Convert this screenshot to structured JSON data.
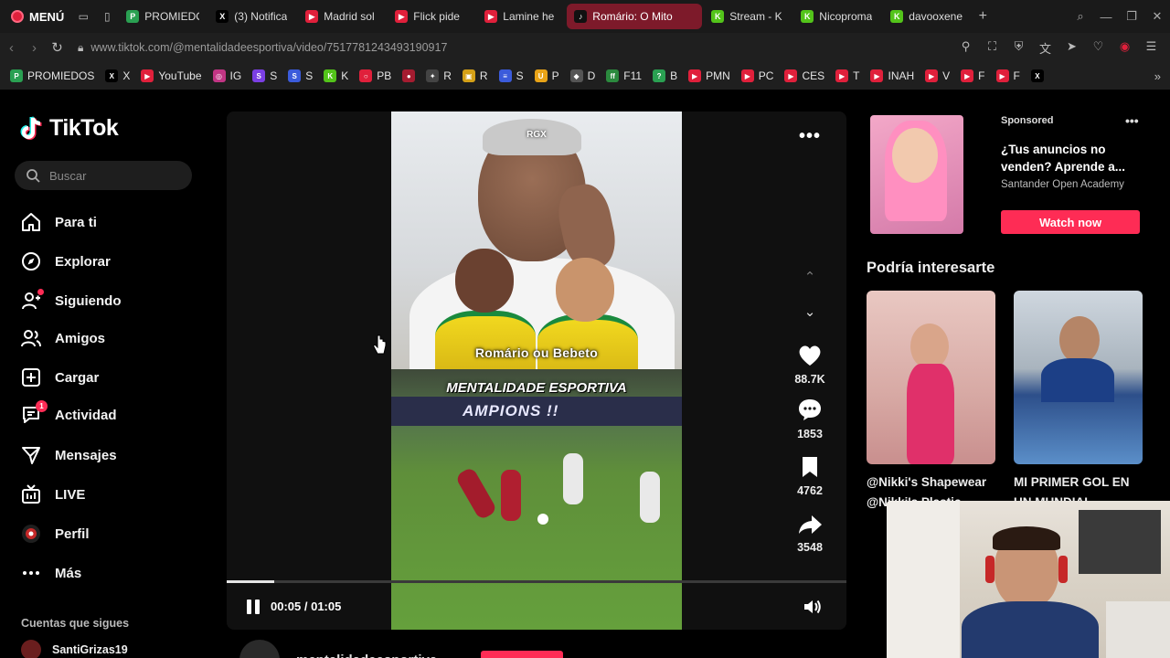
{
  "browser": {
    "menu_label": "MENÚ",
    "tabs": [
      {
        "title": "PROMIEDO",
        "color": "#2aa052",
        "glyph": "P",
        "active": false
      },
      {
        "title": "(3) Notifica",
        "color": "#000000",
        "glyph": "X",
        "active": false
      },
      {
        "title": "Madrid sol",
        "color": "#e0203b",
        "glyph": "▶",
        "active": false
      },
      {
        "title": "Flick pide",
        "color": "#e0203b",
        "glyph": "▶",
        "active": false
      },
      {
        "title": "Lamine he",
        "color": "#e0203b",
        "glyph": "▶",
        "active": false
      },
      {
        "title": "Romário: O Mito",
        "color": "#111111",
        "glyph": "♪",
        "active": true
      },
      {
        "title": "Stream - K",
        "color": "#53c41a",
        "glyph": "K",
        "active": false
      },
      {
        "title": "Nicoproma",
        "color": "#53c41a",
        "glyph": "K",
        "active": false
      },
      {
        "title": "davooxene",
        "color": "#53c41a",
        "glyph": "K",
        "active": false
      }
    ],
    "url": "www.tiktok.com/@mentalidadeesportiva/video/7517781243493190917",
    "bookmarks": [
      {
        "label": "PROMIEDOS",
        "color": "#2aa052",
        "glyph": "P"
      },
      {
        "label": "X",
        "color": "#000000",
        "glyph": "X"
      },
      {
        "label": "YouTube",
        "color": "#e0203b",
        "glyph": "▶"
      },
      {
        "label": "IG",
        "color": "#c13584",
        "glyph": "◎"
      },
      {
        "label": "S",
        "color": "#7b3fe4",
        "glyph": "S"
      },
      {
        "label": "S",
        "color": "#3b5bdb",
        "glyph": "S"
      },
      {
        "label": "K",
        "color": "#53c41a",
        "glyph": "K"
      },
      {
        "label": "PB",
        "color": "#e0203b",
        "glyph": "○"
      },
      {
        "label": "",
        "color": "#a51c30",
        "glyph": "●"
      },
      {
        "label": "R",
        "color": "#444444",
        "glyph": "✦"
      },
      {
        "label": "R",
        "color": "#d4a017",
        "glyph": "▣"
      },
      {
        "label": "S",
        "color": "#3b5bdb",
        "glyph": "≡"
      },
      {
        "label": "P",
        "color": "#e8a317",
        "glyph": "U"
      },
      {
        "label": "D",
        "color": "#555555",
        "glyph": "◆"
      },
      {
        "label": "F11",
        "color": "#2b8a3e",
        "glyph": "ff"
      },
      {
        "label": "B",
        "color": "#2aa052",
        "glyph": "?"
      },
      {
        "label": "PMN",
        "color": "#e0203b",
        "glyph": "▶"
      },
      {
        "label": "PC",
        "color": "#e0203b",
        "glyph": "▶"
      },
      {
        "label": "CES",
        "color": "#e0203b",
        "glyph": "▶"
      },
      {
        "label": "T",
        "color": "#e0203b",
        "glyph": "▶"
      },
      {
        "label": "INAH",
        "color": "#e0203b",
        "glyph": "▶"
      },
      {
        "label": "V",
        "color": "#e0203b",
        "glyph": "▶"
      },
      {
        "label": "F",
        "color": "#e0203b",
        "glyph": "▶"
      },
      {
        "label": "F",
        "color": "#e0203b",
        "glyph": "▶"
      },
      {
        "label": "",
        "color": "#000000",
        "glyph": "X"
      }
    ]
  },
  "tiktok": {
    "logo_text": "TikTok",
    "search_placeholder": "Buscar",
    "nav": [
      {
        "key": "for-you",
        "label": "Para ti",
        "icon": "home-icon"
      },
      {
        "key": "explore",
        "label": "Explorar",
        "icon": "compass-icon"
      },
      {
        "key": "following",
        "label": "Siguiendo",
        "icon": "following-icon"
      },
      {
        "key": "friends",
        "label": "Amigos",
        "icon": "friends-icon"
      },
      {
        "key": "upload",
        "label": "Cargar",
        "icon": "upload-icon"
      },
      {
        "key": "activity",
        "label": "Actividad",
        "icon": "activity-icon",
        "badge": "1"
      },
      {
        "key": "messages",
        "label": "Mensajes",
        "icon": "messages-icon"
      },
      {
        "key": "live",
        "label": "LIVE",
        "icon": "live-icon"
      },
      {
        "key": "profile",
        "label": "Perfil",
        "icon": "profile-icon"
      },
      {
        "key": "more",
        "label": "Más",
        "icon": "more-icon"
      }
    ],
    "following_title": "Cuentas que sigues",
    "following_accounts": [
      {
        "name": "SantiGrizas19"
      }
    ]
  },
  "video": {
    "watermark": "RGX",
    "caption": "Romário ou Bebeto",
    "brand_overlay": "MENTALIDADE ESPORTIVA",
    "banner_text": "AMPIONS !!",
    "likes": "88.7K",
    "comments": "1853",
    "saves": "4762",
    "shares": "3548",
    "time": "00:05 / 01:05",
    "progress_fraction": 0.0769,
    "author": "mentalidadeesportiva"
  },
  "sidebar_right": {
    "sponsored_label": "Sponsored",
    "ad_title": "¿Tus anuncios no venden? Aprende a...",
    "ad_brand": "Santander Open Academy",
    "ad_button": "Watch now",
    "recommend_title": "Podría interesarte",
    "recommendations": [
      {
        "caption": "@Nikki's Shapewear @Nikki's Plastic"
      },
      {
        "caption": "MI PRIMER GOL EN UN MUNDIAL"
      }
    ]
  },
  "colors": {
    "accent": "#fe2c55",
    "background": "#000000",
    "active_tab": "#7d1a2a"
  }
}
